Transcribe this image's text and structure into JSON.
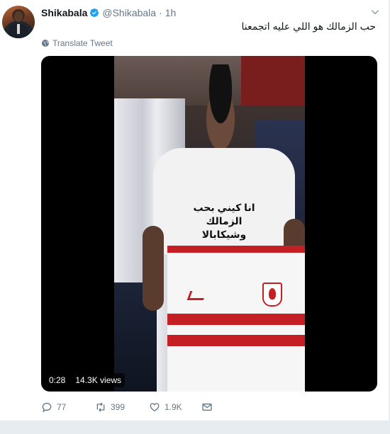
{
  "tweet": {
    "author_name": "Shikabala",
    "handle": "@Shikabala",
    "separator": "·",
    "time": "1h",
    "text": "حب الزمالك هو اللي عليه اتجمعنا",
    "translate_label": "Translate Tweet"
  },
  "media": {
    "duration": "0:28",
    "views": "14.3K views",
    "shirt_text": "انا كيني بحب الزمالك وشيكابالا"
  },
  "actions": {
    "replies": "77",
    "retweets": "399",
    "likes": "1.9K"
  },
  "colors": {
    "verified": "#1da1f2",
    "secondary_text": "#657786",
    "zamalek_red": "#c41f24"
  }
}
